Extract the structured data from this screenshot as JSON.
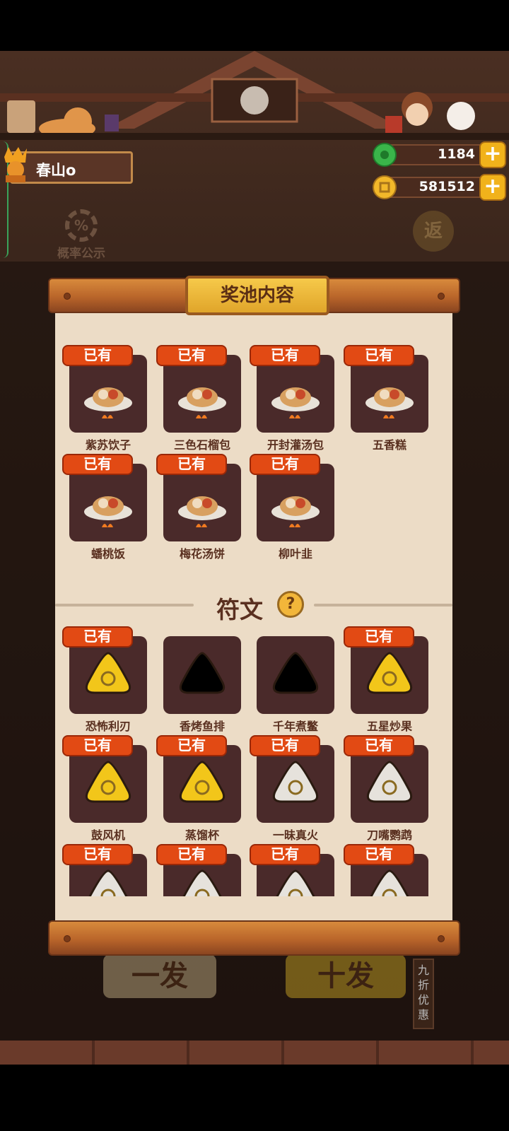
{
  "player": {
    "name": "春山o"
  },
  "resources": {
    "gems": "1184",
    "coins": "581512",
    "plus": "+"
  },
  "probability": {
    "label": "概率公示",
    "symbol": "%"
  },
  "back": {
    "label": "返"
  },
  "draw": {
    "single": "一发",
    "ten": "十发",
    "discount": "九折优惠"
  },
  "panel": {
    "title": "奖池内容",
    "owned_tag": "已有",
    "dishes": [
      {
        "name": "紫苏饮子",
        "owned": true
      },
      {
        "name": "三色石榴包",
        "owned": true
      },
      {
        "name": "开封灌汤包",
        "owned": true
      },
      {
        "name": "五香糕",
        "owned": true
      },
      {
        "name": "蟠桃饭",
        "owned": true
      },
      {
        "name": "梅花汤饼",
        "owned": true
      },
      {
        "name": "柳叶韭",
        "owned": true
      }
    ],
    "runes_title": "符文",
    "runes_help": "?",
    "runes": [
      {
        "name": "恐怖利刃",
        "owned": true,
        "color": "#f2c61a"
      },
      {
        "name": "香烤鱼排",
        "owned": false,
        "color": "#000000"
      },
      {
        "name": "千年煮鳖",
        "owned": false,
        "color": "#000000"
      },
      {
        "name": "五星炒果",
        "owned": true,
        "color": "#f2c61a"
      },
      {
        "name": "鼓风机",
        "owned": true,
        "color": "#f2c61a"
      },
      {
        "name": "蒸馏杯",
        "owned": true,
        "color": "#f2c61a"
      },
      {
        "name": "一昧真火",
        "owned": true,
        "color": "#e6e2dc"
      },
      {
        "name": "刀嘴鹦鹉",
        "owned": true,
        "color": "#e6e2dc"
      },
      {
        "name": "",
        "owned": true,
        "color": "#e6e2dc"
      },
      {
        "name": "",
        "owned": true,
        "color": "#e6e2dc"
      },
      {
        "name": "",
        "owned": true,
        "color": "#e6e2dc"
      },
      {
        "name": "",
        "owned": true,
        "color": "#e6e2dc"
      }
    ]
  },
  "colors": {
    "tag": "#e24a14",
    "paper": "#ecdcc6",
    "title_plate": "#f6c94a"
  }
}
